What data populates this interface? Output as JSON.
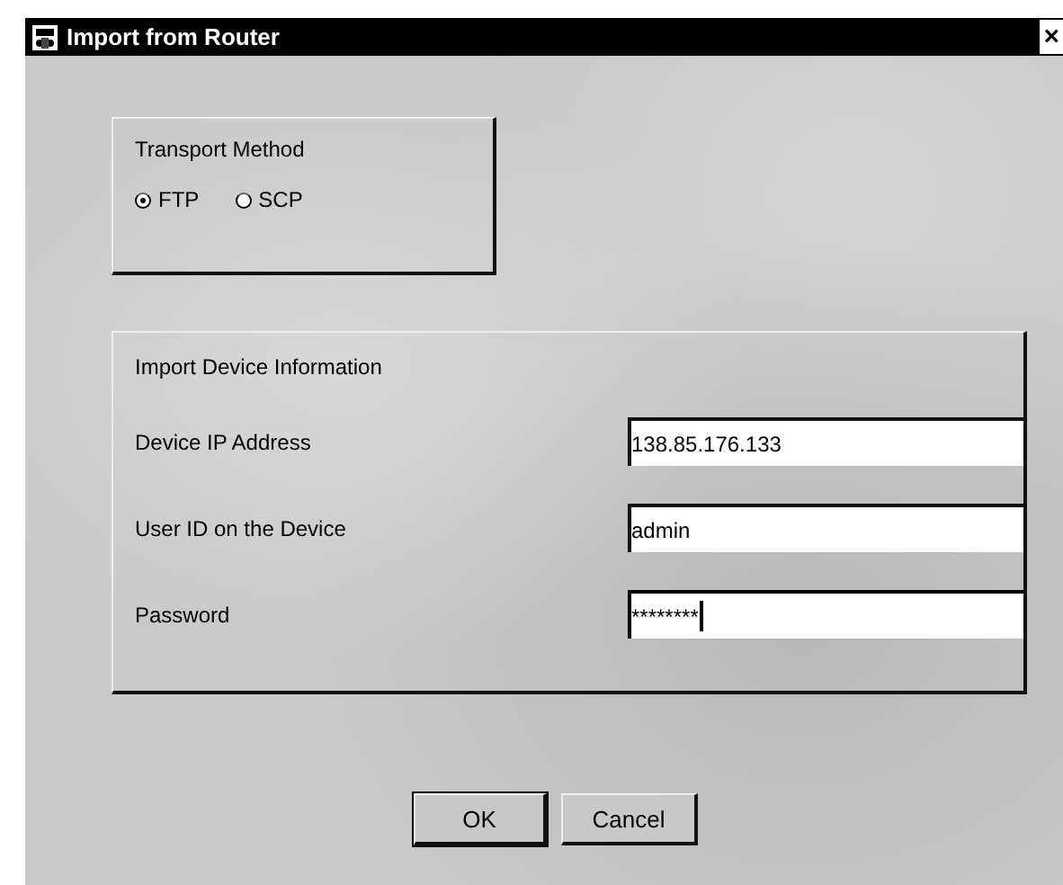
{
  "window": {
    "title": "Import from Router",
    "close": "×"
  },
  "transport": {
    "title": "Transport Method",
    "options": [
      {
        "label": "FTP",
        "selected": true
      },
      {
        "label": "SCP",
        "selected": false
      }
    ]
  },
  "device": {
    "title": "Import Device Information",
    "fields": [
      {
        "label": "Device IP Address",
        "value": "138.85.176.133",
        "focused": false
      },
      {
        "label": "User ID on the Device",
        "value": "admin",
        "focused": false
      },
      {
        "label": "Password",
        "value": "********",
        "focused": true
      }
    ]
  },
  "buttons": [
    {
      "label": "OK",
      "default": true
    },
    {
      "label": "Cancel",
      "default": false
    }
  ]
}
